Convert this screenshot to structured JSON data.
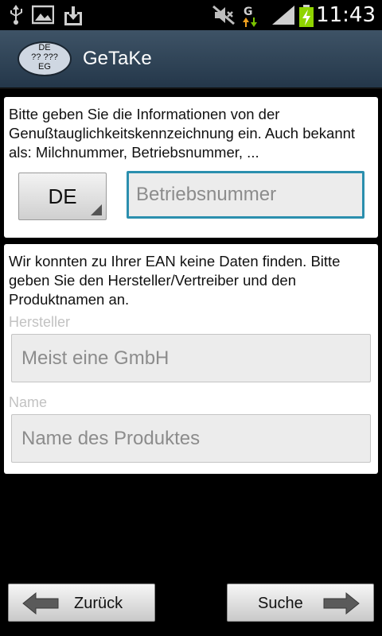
{
  "status_bar": {
    "time": "11:43",
    "icons": [
      "usb-icon",
      "image-icon",
      "download-icon",
      "mute-icon",
      "data-g-icon",
      "signal-icon",
      "battery-charging-icon"
    ]
  },
  "app": {
    "title": "GeTaKe",
    "logo_lines": [
      "DE",
      "?? ???",
      "EG"
    ]
  },
  "identification": {
    "instructions": "Bitte geben Sie die Informationen von der Genußtauglichkeitskennzeichnung ein. Auch bekannt als: Milchnummer, Betriebsnummer, ...",
    "country_selected": "DE",
    "number_placeholder": "Betriebsnummer"
  },
  "manual_entry": {
    "message": "Wir konnten zu Ihrer EAN keine Daten finden. Bitte geben Sie den Hersteller/Vertreiber und den Produktnamen an.",
    "manufacturer_label": "Hersteller",
    "manufacturer_placeholder": "Meist eine GmbH",
    "name_label": "Name",
    "name_placeholder": "Name des Produktes"
  },
  "buttons": {
    "back": "Zurück",
    "search": "Suche"
  },
  "colors": {
    "action_bar": "#2e4356",
    "focus_border": "#2b8fae",
    "battery_charge": "#8fd400"
  }
}
